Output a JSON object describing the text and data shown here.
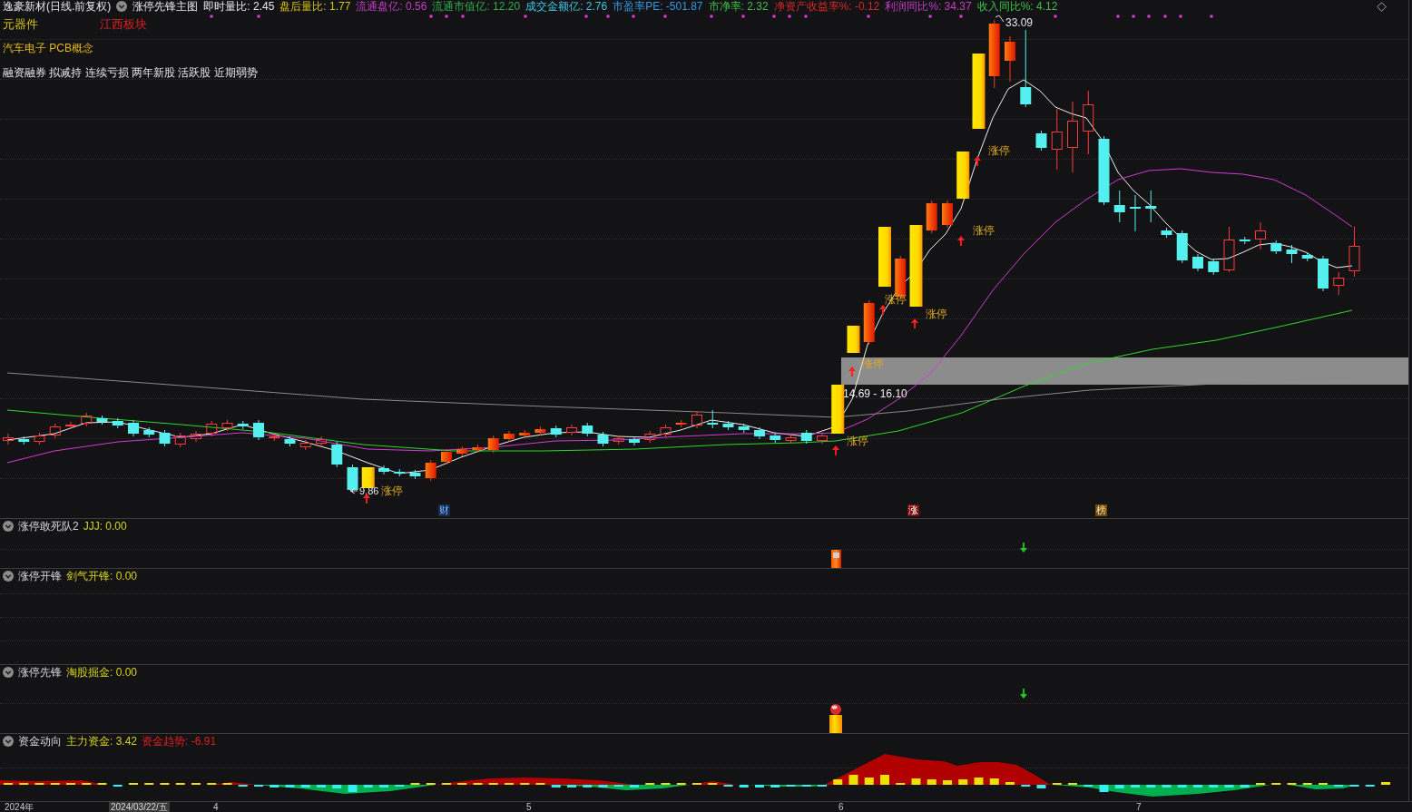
{
  "header": {
    "title": "逸豪新材(日线.前复权)",
    "indicator": "涨停先锋主图",
    "stats": [
      {
        "text": "即时量比: 2.45",
        "color": "#e8e8e8"
      },
      {
        "text": "盘后量比: 1.77",
        "color": "#d4c21c"
      },
      {
        "text": "流通盘亿: 0.56",
        "color": "#c93cc9"
      },
      {
        "text": "流通市值亿: 12.20",
        "color": "#2fb24a"
      },
      {
        "text": "成交金额亿: 2.76",
        "color": "#3cc8e6"
      },
      {
        "text": "市盈率PE: -501.87",
        "color": "#2f9be8"
      },
      {
        "text": "市净率: 2.32",
        "color": "#3cc24a"
      },
      {
        "text": "净资产收益率%: -0.12",
        "color": "#d42a2a"
      },
      {
        "text": "利润同比%: 34.37",
        "color": "#c93cc9"
      },
      {
        "text": "收入同比%: 4.12",
        "color": "#3cc24a"
      }
    ]
  },
  "tags": [
    {
      "text": "元器件",
      "color": "#d4c21c"
    },
    {
      "text": "江西板块",
      "color": "#e02020"
    }
  ],
  "concepts": "汽车电子 PCB概念",
  "flags": "融资融券 拟减持 连续亏损 两年新股 活跃股 近期弱势",
  "chart_labels": {
    "high": "33.09",
    "low": "9.86",
    "band": "14.69 - 16.10",
    "limit_up": [
      "涨停",
      "涨停",
      "涨停",
      "涨停",
      "涨停",
      "涨停",
      "涨停"
    ]
  },
  "markers": [
    {
      "text": "财",
      "kind": "finance"
    },
    {
      "text": "涨",
      "kind": "rise"
    },
    {
      "text": "榜",
      "kind": "list"
    }
  ],
  "panels": [
    {
      "name": "涨停敢死队2",
      "readings": [
        {
          "text": "JJJ: 0.00",
          "color": "#d4d41c"
        }
      ]
    },
    {
      "name": "涨停开锋",
      "readings": [
        {
          "text": "剑气开锋: 0.00",
          "color": "#d4d41c"
        }
      ]
    },
    {
      "name": "涨停先锋",
      "readings": [
        {
          "text": "淘股掘金: 0.00",
          "color": "#d4d41c"
        }
      ]
    },
    {
      "name": "资金动向",
      "readings": [
        {
          "text": "主力资金: 3.42",
          "color": "#d4d41c"
        },
        {
          "text": "资金趋势: -6.91",
          "color": "#e02020"
        }
      ]
    }
  ],
  "axis": {
    "year": "2024年",
    "cursor_date": "2024/03/22/五",
    "months": [
      "4",
      "5",
      "6",
      "7"
    ]
  }
}
